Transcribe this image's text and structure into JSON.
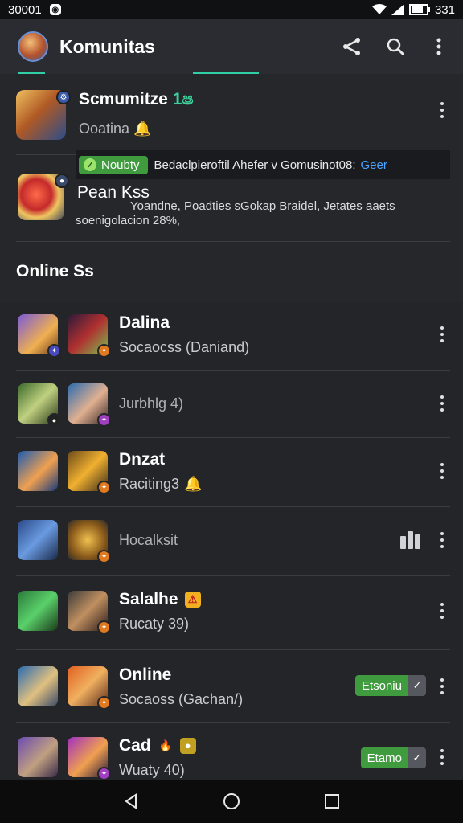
{
  "status_bar": {
    "time": "30001",
    "app_icon": "app-icon",
    "battery_text": "331"
  },
  "app_bar": {
    "title": "Komunitas",
    "icons": [
      "share-icon",
      "search-icon",
      "more-vert-icon"
    ]
  },
  "communities": [
    {
      "title": "Scmumitze",
      "title_accent": "1ෂ",
      "subtitle": "Ooatina",
      "subtitle_emoji": "🔔",
      "icon": "warrior-game-icon"
    },
    {
      "title": "Pean Kss",
      "subtitle_line1": "Yoandne, Poadties sGokap Braidel, Jetates aaets",
      "subtitle_line2": "soenigolacion 28%,",
      "icon": "horn-game-icon"
    }
  ],
  "banner": {
    "chip_label": "Noubty",
    "text": "Bedaclpieroftil Ahefer v Gomusinot08:",
    "link": "Geer"
  },
  "section": {
    "title": "Online Ss"
  },
  "rows": [
    {
      "name": "Dalina",
      "status": "Socaocss (Daniand)",
      "name_emoji": "",
      "status_emoji": ""
    },
    {
      "name": "",
      "status": "Jurbhlg 4)",
      "name_emoji": "",
      "status_emoji": ""
    },
    {
      "name": "Dnzat",
      "status": "Raciting3",
      "name_emoji": "",
      "status_emoji": "🔔"
    },
    {
      "name": "",
      "status": "Hocalksit",
      "name_emoji": "",
      "status_emoji": ""
    },
    {
      "name": "Salalhe",
      "status": "Rucaty 39)",
      "name_emoji": "⚠",
      "status_emoji": ""
    },
    {
      "name": "Online",
      "status": "Socaoss (Gachan/)",
      "name_emoji": "",
      "status_emoji": "",
      "pill": "Etsoniu"
    },
    {
      "name": "Cad",
      "status": "Wuaty 40)",
      "name_emoji": "🔥",
      "status_emoji": "",
      "pill": "Etamo"
    }
  ],
  "colors": {
    "accent": "#2fd0a6",
    "pill_green": "#3f9b3e",
    "link": "#4aa3ff"
  },
  "nav": {
    "icons": [
      "back-icon",
      "home-icon",
      "recents-icon"
    ]
  }
}
